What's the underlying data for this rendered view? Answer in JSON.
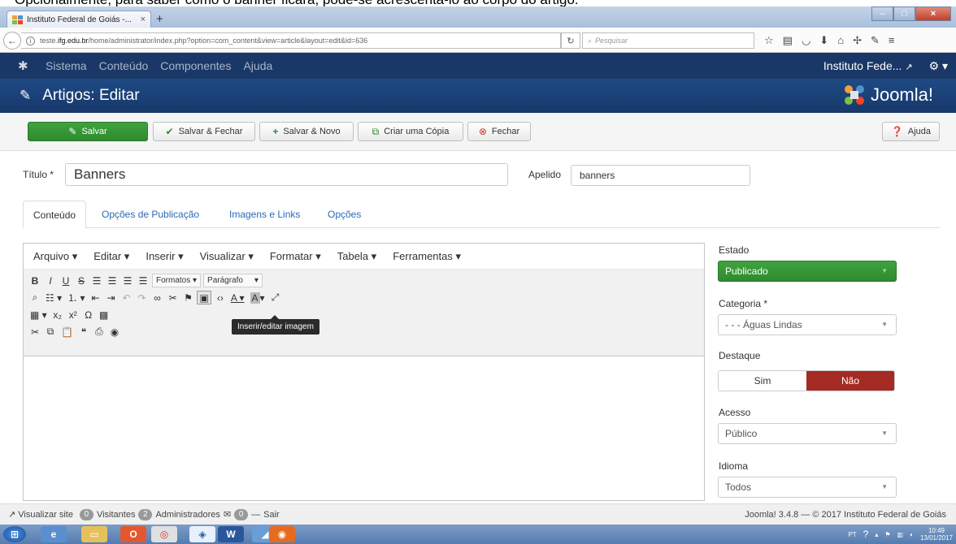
{
  "caption": "Opcionalmente, para saber como o banner ficará, pode-se acrescentá-lo ao corpo do artigo.",
  "browser": {
    "tab_title": "Instituto Federal de Goiás -...",
    "url_prefix": "teste.",
    "url_host": "ifg.edu.br",
    "url_path": "/home/administrator/index.php?option=com_content&view=article&layout=edit&id=636",
    "search_placeholder": "Pesquisar"
  },
  "header": {
    "menu": [
      "Sistema",
      "Conteúdo",
      "Componentes",
      "Ajuda"
    ],
    "site_name": "Instituto Fede...",
    "page_title": "Artigos: Editar",
    "brand": "Joomla!"
  },
  "toolbar": {
    "save": "Salvar",
    "save_close": "Salvar & Fechar",
    "save_new": "Salvar & Novo",
    "copy": "Criar uma Cópia",
    "close": "Fechar",
    "help": "Ajuda"
  },
  "form": {
    "title_label": "Título *",
    "title_value": "Banners",
    "alias_label": "Apelido",
    "alias_value": "banners"
  },
  "tabs": [
    "Conteúdo",
    "Opções de Publicação",
    "Imagens e Links",
    "Opções"
  ],
  "editor": {
    "menu": [
      "Arquivo",
      "Editar",
      "Inserir",
      "Visualizar",
      "Formatar",
      "Tabela",
      "Ferramentas"
    ],
    "formats": "Formatos",
    "paragraph": "Parágrafo",
    "tooltip": "Inserir/editar imagem"
  },
  "side": {
    "status_label": "Estado",
    "status_value": "Publicado",
    "category_label": "Categoria *",
    "category_value": "- - - Águas Lindas",
    "featured_label": "Destaque",
    "featured_yes": "Sim",
    "featured_no": "Não",
    "access_label": "Acesso",
    "access_value": "Público",
    "language_label": "Idioma",
    "language_value": "Todos"
  },
  "statusbar": {
    "view_site": "Visualizar site",
    "visitors_count": "0",
    "visitors": "Visitantes",
    "admins_count": "2",
    "admins": "Administradores",
    "messages_count": "0",
    "logout": "Sair",
    "version": "Joomla! 3.4.8 — © 2017 Instituto Federal de Goiás"
  },
  "taskbar": {
    "lang": "PT",
    "time": "10:49",
    "date": "13/01/2017"
  },
  "colors": {
    "header_dark": "#1a3867",
    "header_sub": "#1f4a85",
    "green": "#2e8a2e",
    "red": "#a52a24",
    "link": "#2a69b8"
  }
}
